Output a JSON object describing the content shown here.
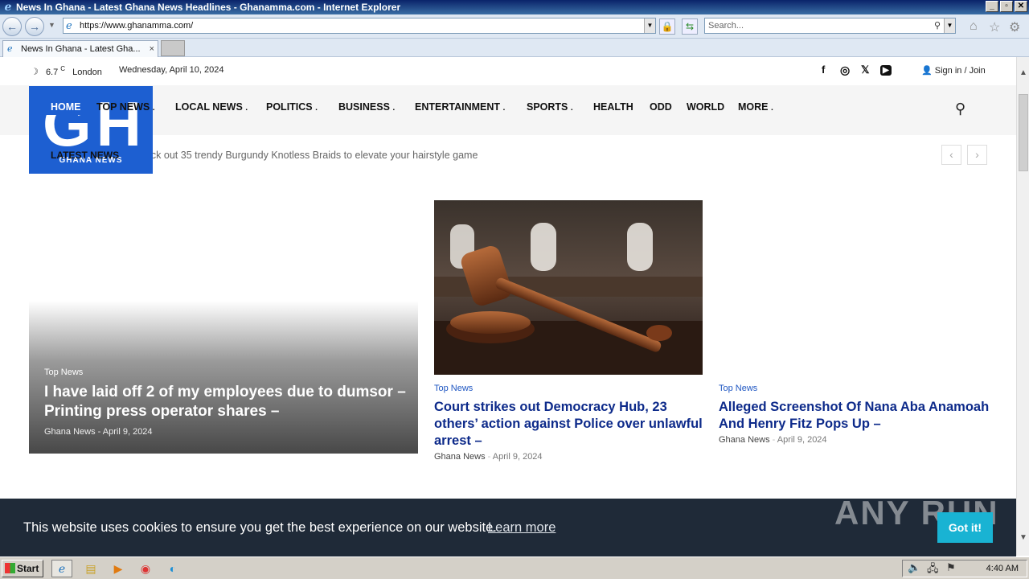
{
  "window": {
    "title": "News In Ghana - Latest Ghana News Headlines - Ghanamma.com - Internet Explorer",
    "controls": [
      "_",
      "▫",
      "✕"
    ]
  },
  "browser": {
    "url": "https://www.ghanamma.com/",
    "search_placeholder": "Search...",
    "tab_title": "News In Ghana - Latest Gha...",
    "tab_close": "×"
  },
  "site": {
    "topbar": {
      "weather_icon": "moon-icon",
      "temp": "6.7",
      "unit": "C",
      "city": "London",
      "date": "Wednesday, April 10, 2024",
      "social": [
        "facebook-icon",
        "instagram-icon",
        "x-icon",
        "youtube-icon"
      ],
      "signin": "Sign in / Join"
    },
    "logo": {
      "letters": "GH",
      "subtitle": "GHANA NEWS"
    },
    "menu": [
      {
        "label": "HOME"
      },
      {
        "label": "TOP NEWS"
      },
      {
        "label": "LOCAL NEWS"
      },
      {
        "label": "POLITICS"
      },
      {
        "label": "BUSINESS"
      },
      {
        "label": "ENTERTAINMENT"
      },
      {
        "label": "SPORTS"
      },
      {
        "label": "HEALTH"
      },
      {
        "label": "ODD"
      },
      {
        "label": "WORLD"
      },
      {
        "label": "MORE"
      }
    ],
    "ticker": {
      "label": "LATEST NEWS",
      "text": "Check out 35 trendy Burgundy Knotless Braids to elevate your hairstyle game",
      "prev": "‹",
      "next": "›"
    },
    "featured": {
      "category": "Top News",
      "title": "I have laid off 2 of my employees due to dumsor – Printing press operator shares –",
      "author": "Ghana News",
      "date": "April 9, 2024"
    },
    "cards": [
      {
        "category": "Top News",
        "title": "Court strikes out Democracy Hub, 23 others’ action against Police over unlawful arrest –",
        "author": "Ghana News",
        "date": "April 9, 2024"
      },
      {
        "category": "Top News",
        "title": "Alleged Screenshot Of Nana Aba Anamoah And Henry Fitz Pops Up –",
        "author": "Ghana News",
        "date": "April 9, 2024"
      }
    ]
  },
  "cookie": {
    "message": "This website uses cookies to ensure you get the best experience on our website.",
    "learn_more": "Learn more",
    "button": "Got it!",
    "watermark": "ANY RUN"
  },
  "taskbar": {
    "start": "Start",
    "clock": "4:40 AM"
  },
  "colors": {
    "brand_blue": "#1d5fd1",
    "headline_blue": "#0d2a8a",
    "cookie_bg": "#1f2a38",
    "cookie_button": "#19b3d3"
  }
}
